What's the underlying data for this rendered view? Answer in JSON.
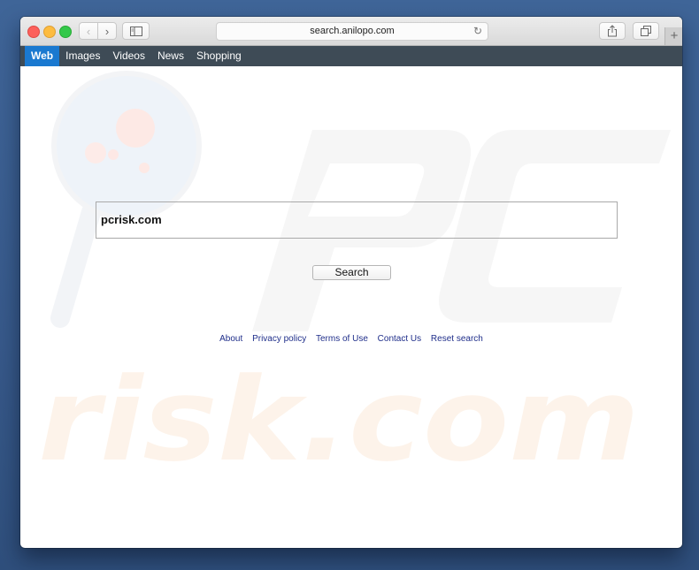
{
  "browser": {
    "url": "search.anilopo.com",
    "icons": {
      "back": "chevron-left-icon",
      "forward": "chevron-right-icon",
      "sidebar": "sidebar-icon",
      "reload": "reload-icon",
      "share": "share-icon",
      "tabs": "tabs-icon",
      "new_tab": "plus-icon"
    },
    "glyphs": {
      "back": "‹",
      "forward": "›",
      "reload": "↻",
      "new_tab": "+"
    }
  },
  "nav": {
    "items": [
      {
        "label": "Web",
        "active": true
      },
      {
        "label": "Images",
        "active": false
      },
      {
        "label": "Videos",
        "active": false
      },
      {
        "label": "News",
        "active": false
      },
      {
        "label": "Shopping",
        "active": false
      }
    ]
  },
  "search": {
    "value": "pcrisk.com",
    "button_label": "Search"
  },
  "footer": {
    "links": [
      "About",
      "Privacy policy",
      "Terms of Use",
      "Contact Us",
      "Reset search"
    ]
  },
  "watermark": {
    "top": "PC",
    "bottom": "risk.com"
  },
  "colors": {
    "nav_bg": "#3e4b56",
    "nav_active": "#1a79d0",
    "link": "#1f2e8a"
  }
}
